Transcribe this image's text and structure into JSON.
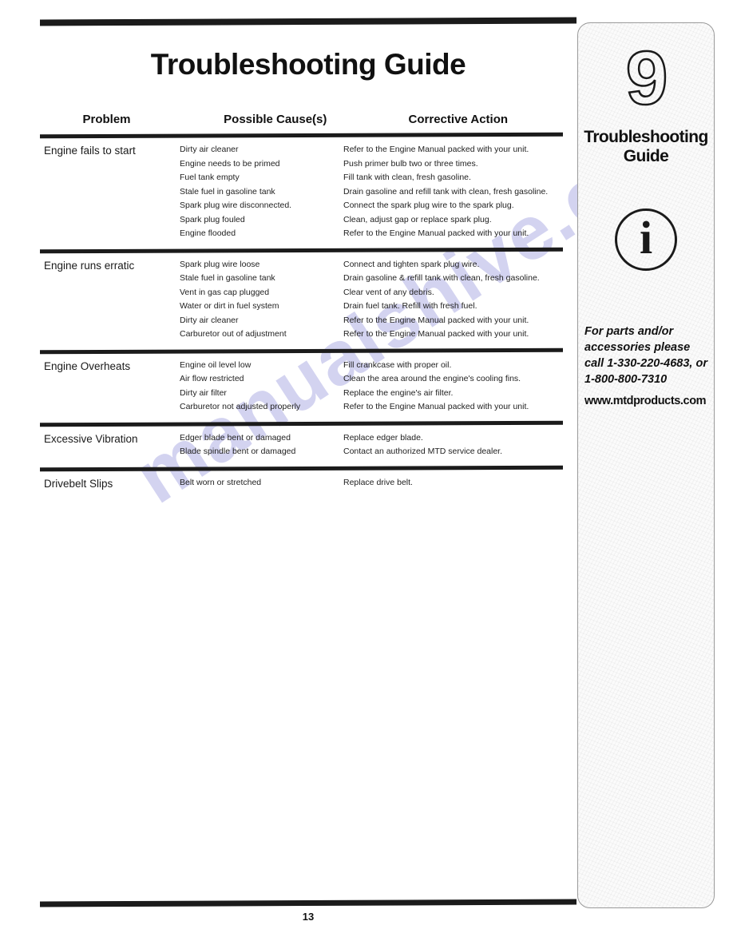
{
  "page": {
    "title": "Troubleshooting Guide",
    "page_number": "13",
    "watermark": "manualshive.com"
  },
  "table": {
    "headers": {
      "problem": "Problem",
      "cause": "Possible Cause(s)",
      "action": "Corrective Action"
    },
    "sections": [
      {
        "problem": "Engine fails to start",
        "rows": [
          {
            "cause": "Dirty air cleaner",
            "action": "Refer to the Engine Manual packed with your unit."
          },
          {
            "cause": "Engine needs to be primed",
            "action": "Push primer bulb two or three times."
          },
          {
            "cause": "Fuel tank empty",
            "action": "Fill tank with clean, fresh gasoline."
          },
          {
            "cause": "Stale fuel in gasoline tank",
            "action": "Drain gasoline and refill tank with clean, fresh gasoline."
          },
          {
            "cause": "Spark plug wire disconnected.",
            "action": "Connect the spark plug wire to the spark plug."
          },
          {
            "cause": "Spark plug fouled",
            "action": "Clean, adjust gap or replace spark plug."
          },
          {
            "cause": "Engine flooded",
            "action": "Refer to the Engine Manual packed with your unit."
          }
        ]
      },
      {
        "problem": "Engine runs erratic",
        "rows": [
          {
            "cause": "Spark plug wire loose",
            "action": "Connect and tighten spark plug wire."
          },
          {
            "cause": "Stale fuel in gasoline tank",
            "action": "Drain gasoline & refill tank with clean, fresh gasoline."
          },
          {
            "cause": "Vent in gas cap plugged",
            "action": "Clear vent of any debris."
          },
          {
            "cause": "Water or dirt in fuel system",
            "action": "Drain fuel tank. Refill with fresh fuel."
          },
          {
            "cause": "Dirty air cleaner",
            "action": "Refer to the Engine Manual packed with your unit."
          },
          {
            "cause": "Carburetor out of adjustment",
            "action": "Refer to the Engine Manual packed with your unit."
          }
        ]
      },
      {
        "problem": "Engine Overheats",
        "rows": [
          {
            "cause": "Engine oil level low",
            "action": "Fill crankcase with proper oil."
          },
          {
            "cause": "Air flow restricted",
            "action": "Clean the area around the engine's cooling fins."
          },
          {
            "cause": "Dirty air filter",
            "action": "Replace the engine's air filter."
          },
          {
            "cause": "Carburetor not adjusted properly",
            "action": "Refer to the Engine Manual packed with your unit."
          }
        ]
      },
      {
        "problem": "Excessive Vibration",
        "rows": [
          {
            "cause": "Edger blade bent or damaged",
            "action": "Replace edger blade."
          },
          {
            "cause": "Blade spindle bent or damaged",
            "action": "Contact an authorized MTD service dealer."
          }
        ]
      },
      {
        "problem": "Drivebelt Slips",
        "rows": [
          {
            "cause": "Belt worn or stretched",
            "action": "Replace drive belt."
          }
        ]
      }
    ]
  },
  "sidebar": {
    "chapter_number": "9",
    "chapter_title": "Troubleshooting Guide",
    "info_icon": "information-icon",
    "info_glyph": "i",
    "contact_text": "For parts and/or accessories please call 1-330-220-4683, or 1-800-800-7310",
    "website": "www.mtdproducts.com"
  }
}
